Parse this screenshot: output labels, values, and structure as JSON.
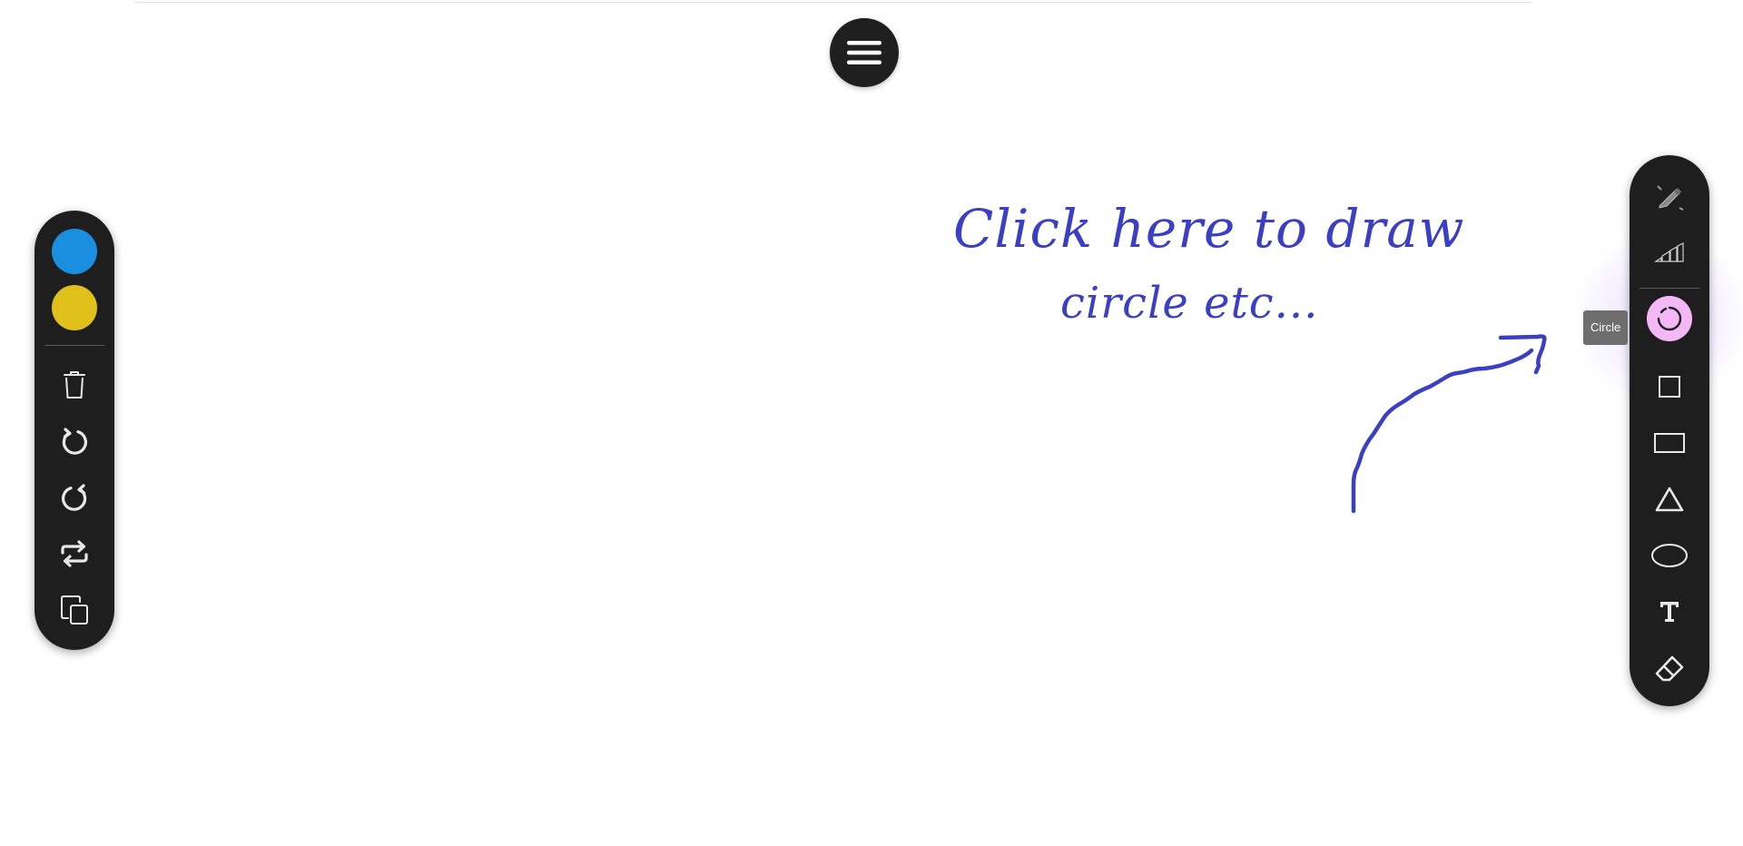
{
  "hint": {
    "line1": "Click here to draw",
    "line2": "circle etc..."
  },
  "tooltip": {
    "label": "Circle"
  },
  "left_toolbar": {
    "colors": [
      {
        "name": "blue",
        "hex": "#1a8fe0"
      },
      {
        "name": "yellow",
        "hex": "#e0c01a"
      }
    ],
    "actions": [
      "trash-icon",
      "undo-icon",
      "redo-icon",
      "swap-icon",
      "copy-icon"
    ]
  },
  "right_toolbar": {
    "tools": [
      "pen-icon",
      "stroke-width-icon",
      "circle-tool-icon",
      "square-icon",
      "rectangle-icon",
      "triangle-icon",
      "ellipse-icon",
      "text-icon",
      "eraser-icon"
    ],
    "active_tool": "Circle",
    "active_color": "#f4b8f6"
  },
  "colors": {
    "hint_text": "#3b3fc4",
    "toolbar_bg": "#1e1e1e",
    "icon": "#e8e8e8"
  }
}
